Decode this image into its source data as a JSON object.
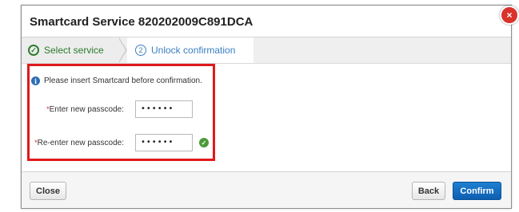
{
  "dialog": {
    "title": "Smartcard Service 820202009C891DCA",
    "close_glyph": "×"
  },
  "steps": [
    {
      "label": "Select service",
      "state": "completed",
      "icon": "check-circle-icon"
    },
    {
      "label": "Unlock confirmation",
      "number": "2",
      "state": "active"
    }
  ],
  "form": {
    "info_text": "Please insert Smartcard before confirmation.",
    "required_marker": "*",
    "fields": [
      {
        "label": "Enter new passcode:",
        "value": "••••••"
      },
      {
        "label": "Re-enter new passcode:",
        "value": "••••••",
        "validated": true
      }
    ]
  },
  "footer": {
    "close_label": "Close",
    "back_label": "Back",
    "confirm_label": "Confirm"
  },
  "colors": {
    "primary": "#1670c8",
    "success": "#2f7d2f",
    "highlight": "#e0191c",
    "close_badge": "#d9322b"
  }
}
